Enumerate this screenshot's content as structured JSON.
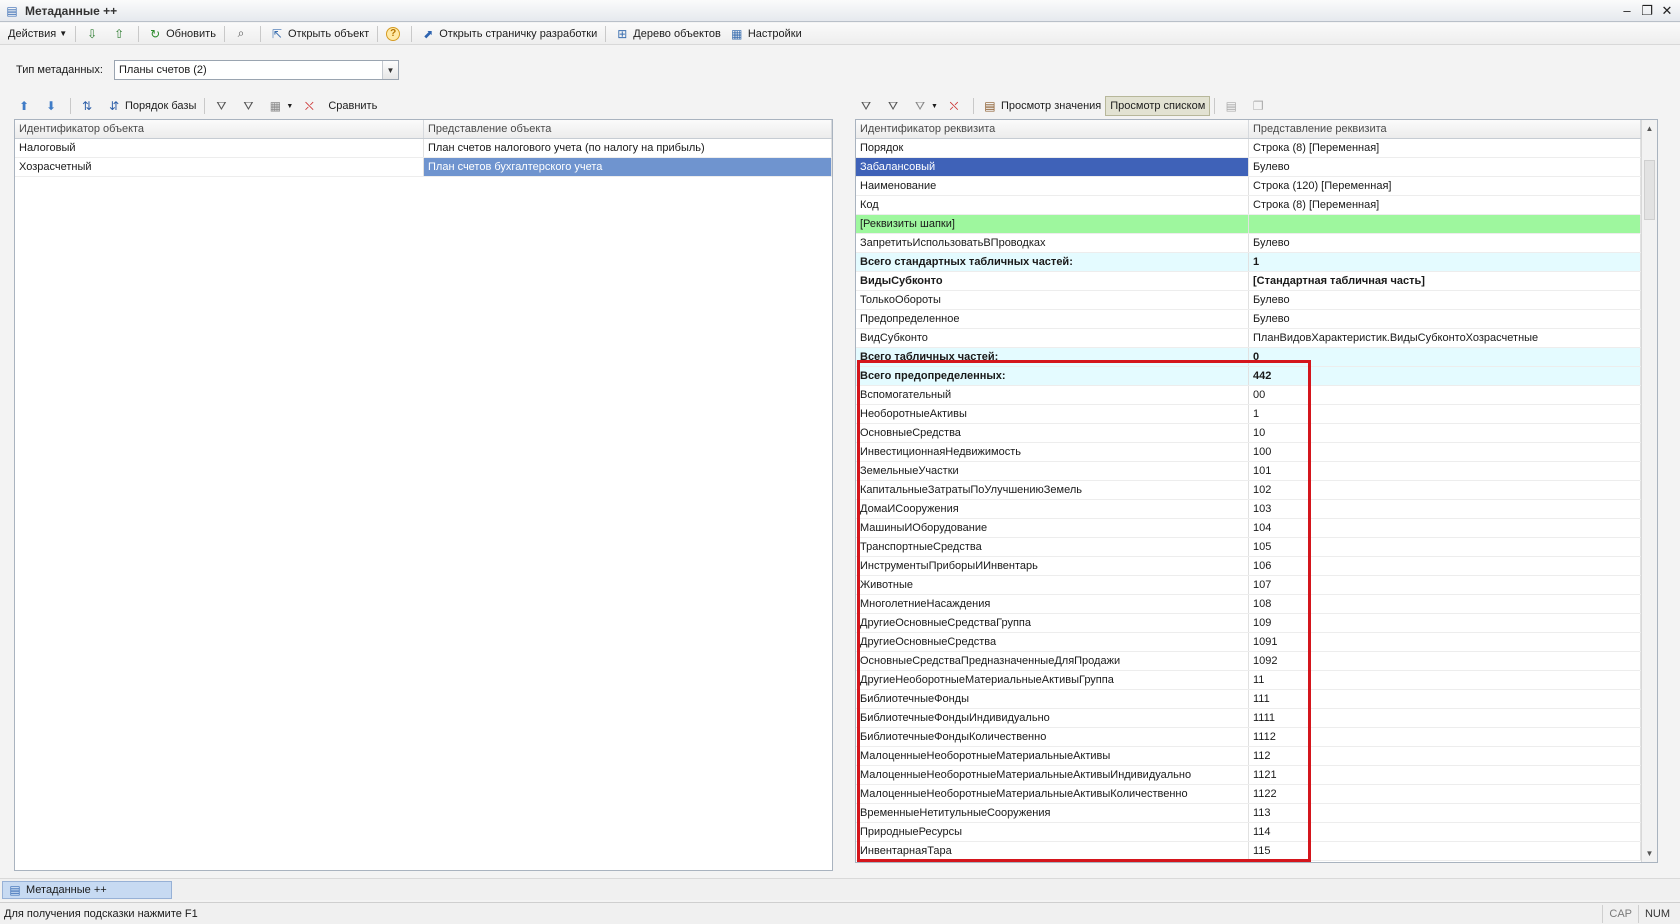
{
  "window": {
    "title": "Метаданные ++",
    "controls": [
      "‒",
      "❐",
      "✕"
    ]
  },
  "toolbar": {
    "actions_label": "Действия",
    "refresh_label": "Обновить",
    "open_object_label": "Открыть объект",
    "help_label": "?",
    "open_dev_page_label": "Открыть страничку разработки",
    "object_tree_label": "Дерево объектов",
    "settings_label": "Настройки"
  },
  "metadata_type": {
    "label": "Тип метаданных:",
    "value": "Планы счетов (2)"
  },
  "left_toolbar": {
    "base_order_label": "Порядок базы",
    "compare_label": "Сравнить"
  },
  "left_grid": {
    "headers": [
      "Идентификатор объекта",
      "Представление объекта"
    ],
    "rows": [
      {
        "id": "Налоговый",
        "repr": "План счетов налогового учета (по налогу на прибыль)"
      },
      {
        "id": "Хозрасчетный",
        "repr": "План счетов бухгалтерского учета"
      }
    ],
    "selected_row": 1
  },
  "right_toolbar": {
    "view_value_label": "Просмотр значения",
    "view_list_label": "Просмотр списком"
  },
  "right_grid": {
    "headers": [
      "Идентификатор реквизита",
      "Представление реквизита"
    ],
    "rows": [
      {
        "id": "Порядок",
        "repr": "Строка (8) [Переменная]",
        "style": ""
      },
      {
        "id": "Забалансовый",
        "repr": "Булево",
        "style": "sel-r"
      },
      {
        "id": "Наименование",
        "repr": "Строка (120) [Переменная]",
        "style": ""
      },
      {
        "id": "Код",
        "repr": "Строка (8) [Переменная]",
        "style": ""
      },
      {
        "id": "[Реквизиты шапки]",
        "repr": "",
        "style": "green"
      },
      {
        "id": "ЗапретитьИспользоватьВПроводках",
        "repr": "Булево",
        "style": ""
      },
      {
        "id": "Всего стандартных табличных частей:",
        "repr": "1",
        "style": "cyan"
      },
      {
        "id": "ВидыСубконто",
        "repr": "[Стандартная табличная часть]",
        "style": "bold"
      },
      {
        "id": "ТолькоОбороты",
        "repr": "Булево",
        "style": ""
      },
      {
        "id": "Предопределенное",
        "repr": "Булево",
        "style": ""
      },
      {
        "id": "ВидСубконто",
        "repr": "ПланВидовХарактеристик.ВидыСубконтоХозрасчетные",
        "style": ""
      },
      {
        "id": "Всего табличных частей:",
        "repr": "0",
        "style": "cyan"
      },
      {
        "id": "Всего предопределенных:",
        "repr": "442",
        "style": "cyan"
      },
      {
        "id": "Вспомогательный",
        "repr": "00",
        "style": ""
      },
      {
        "id": "НеоборотныеАктивы",
        "repr": "1",
        "style": ""
      },
      {
        "id": "ОсновныеСредства",
        "repr": "10",
        "style": ""
      },
      {
        "id": "ИнвестиционнаяНедвижимость",
        "repr": "100",
        "style": ""
      },
      {
        "id": "ЗемельныеУчастки",
        "repr": "101",
        "style": ""
      },
      {
        "id": "КапитальныеЗатратыПоУлучшениюЗемель",
        "repr": "102",
        "style": ""
      },
      {
        "id": "ДомаИСооружения",
        "repr": "103",
        "style": ""
      },
      {
        "id": "МашиныИОборудование",
        "repr": "104",
        "style": ""
      },
      {
        "id": "ТранспортныеСредства",
        "repr": "105",
        "style": ""
      },
      {
        "id": "ИнструментыПриборыИИнвентарь",
        "repr": "106",
        "style": ""
      },
      {
        "id": "Животные",
        "repr": "107",
        "style": ""
      },
      {
        "id": "МноголетниеНасаждения",
        "repr": "108",
        "style": ""
      },
      {
        "id": "ДругиеОсновныеСредстваГруппа",
        "repr": "109",
        "style": ""
      },
      {
        "id": "ДругиеОсновныеСредства",
        "repr": "1091",
        "style": ""
      },
      {
        "id": "ОсновныеСредстваПредназначенныеДляПродажи",
        "repr": "1092",
        "style": ""
      },
      {
        "id": "ДругиеНеоборотныеМатериальныеАктивыГруппа",
        "repr": "11",
        "style": ""
      },
      {
        "id": "БиблиотечныеФонды",
        "repr": "111",
        "style": ""
      },
      {
        "id": "БиблиотечныеФондыИндивидуально",
        "repr": "1111",
        "style": ""
      },
      {
        "id": "БиблиотечныеФондыКоличественно",
        "repr": "1112",
        "style": ""
      },
      {
        "id": "МалоценныеНеоборотныеМатериальныеАктивы",
        "repr": "112",
        "style": ""
      },
      {
        "id": "МалоценныеНеоборотныеМатериальныеАктивыИндивидуально",
        "repr": "1121",
        "style": ""
      },
      {
        "id": "МалоценныеНеоборотныеМатериальныеАктивыКоличественно",
        "repr": "1122",
        "style": ""
      },
      {
        "id": "ВременныеНетитульныеСооружения",
        "repr": "113",
        "style": ""
      },
      {
        "id": "ПриродныеРесурсы",
        "repr": "114",
        "style": ""
      },
      {
        "id": "ИнвентарнаяТара",
        "repr": "115",
        "style": ""
      }
    ]
  },
  "taskbar": {
    "tab_label": "Метаданные ++"
  },
  "statusbar": {
    "hint": "Для получения подсказки нажмите F1",
    "cap": "CAP",
    "num": "NUM"
  },
  "colors": {
    "selection_blue": "#3f62b8",
    "selection_light_blue": "#6f94cf",
    "group_green": "#9ef79e",
    "summary_cyan": "#e4fbff",
    "highlight_red": "#d4151c"
  }
}
